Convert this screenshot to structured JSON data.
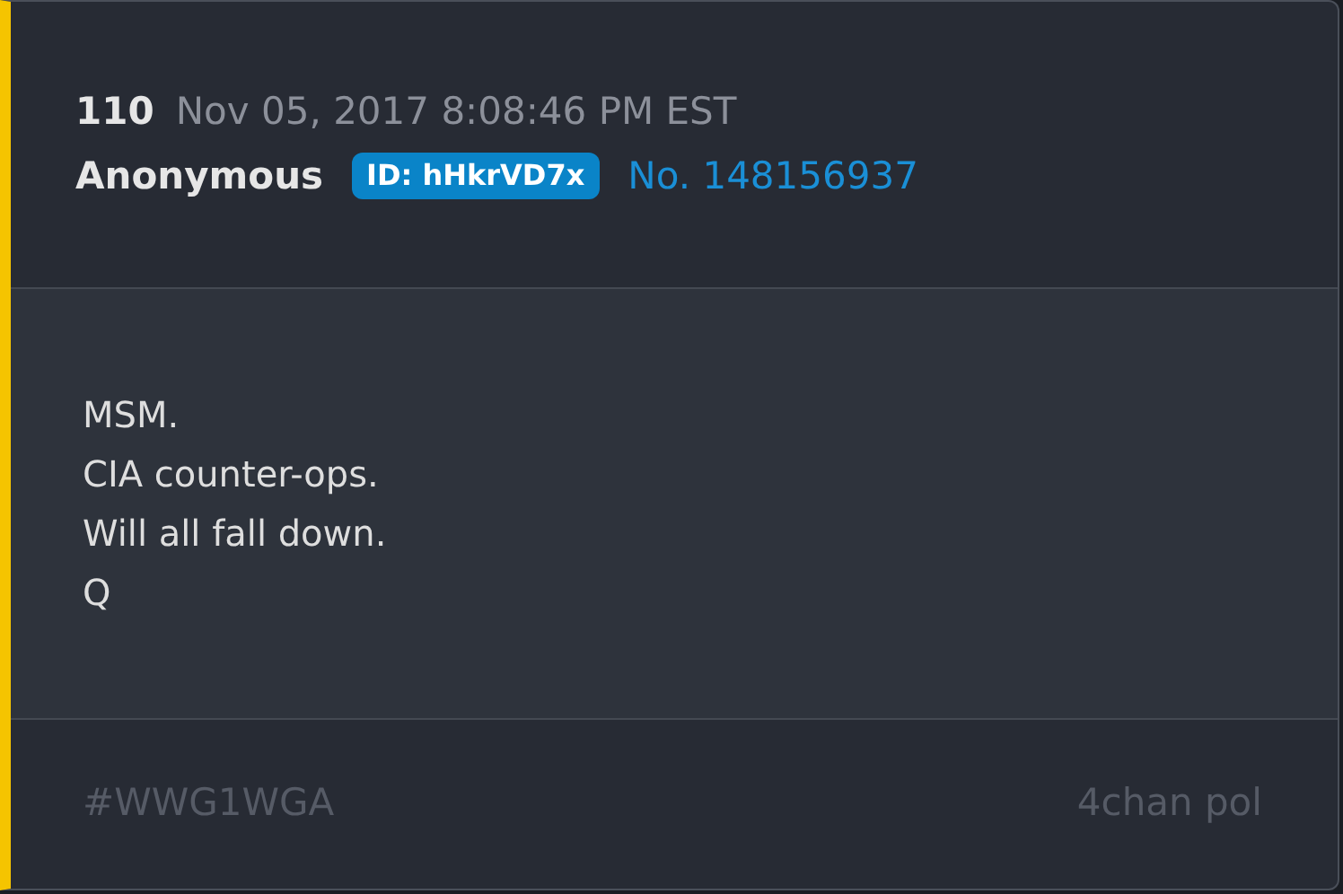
{
  "post": {
    "number": "110",
    "timestamp": "Nov 05, 2017 8:08:46 PM EST",
    "author": "Anonymous",
    "id_badge": "ID: hHkrVD7x",
    "post_link": "No. 148156937",
    "lines": [
      "MSM.",
      "CIA counter-ops.",
      "Will all fall down.",
      "Q"
    ],
    "hashtag": "#WWG1WGA",
    "source": "4chan pol"
  }
}
